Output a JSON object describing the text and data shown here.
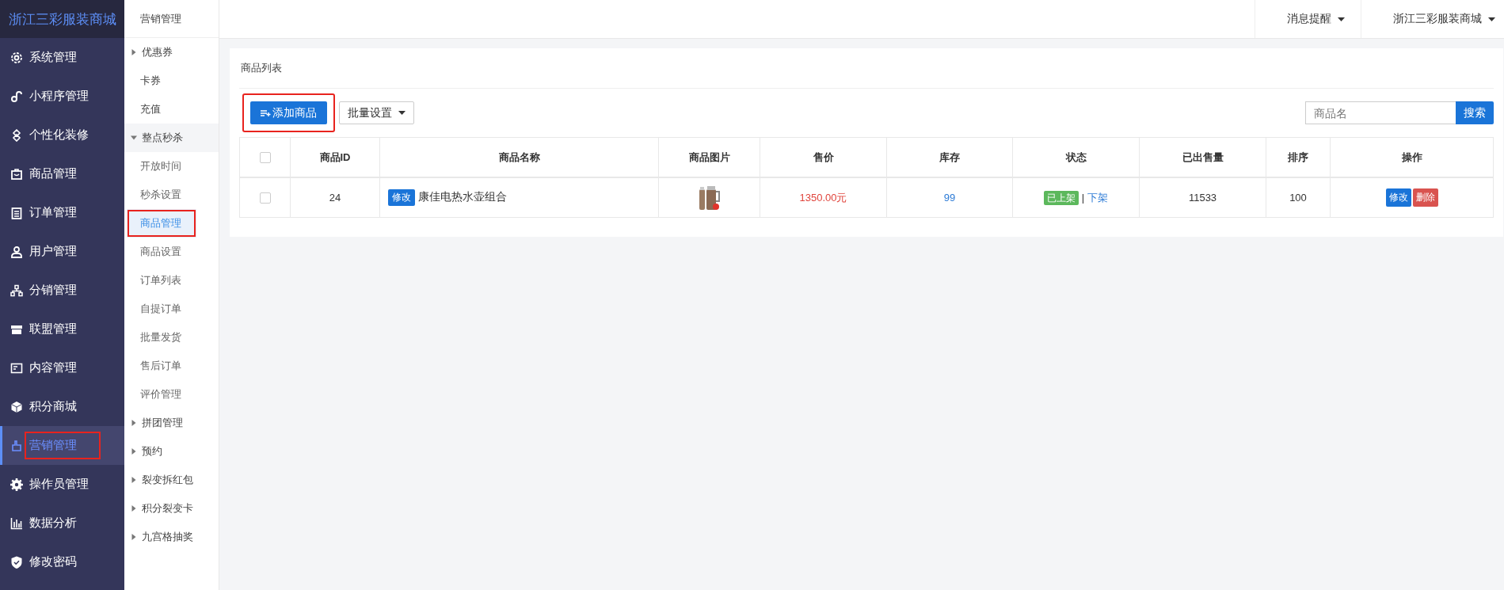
{
  "brand": "浙江三彩服装商城",
  "sidebar": {
    "items": [
      {
        "label": "系统管理",
        "selected": false,
        "annotated": false
      },
      {
        "label": "小程序管理",
        "selected": false,
        "annotated": false
      },
      {
        "label": "个性化装修",
        "selected": false,
        "annotated": false
      },
      {
        "label": "商品管理",
        "selected": false,
        "annotated": false
      },
      {
        "label": "订单管理",
        "selected": false,
        "annotated": false
      },
      {
        "label": "用户管理",
        "selected": false,
        "annotated": false
      },
      {
        "label": "分销管理",
        "selected": false,
        "annotated": false
      },
      {
        "label": "联盟管理",
        "selected": false,
        "annotated": false
      },
      {
        "label": "内容管理",
        "selected": false,
        "annotated": false
      },
      {
        "label": "积分商城",
        "selected": false,
        "annotated": false
      },
      {
        "label": "营销管理",
        "selected": true,
        "annotated": true
      },
      {
        "label": "操作员管理",
        "selected": false,
        "annotated": false
      },
      {
        "label": "数据分析",
        "selected": false,
        "annotated": false
      },
      {
        "label": "修改密码",
        "selected": false,
        "annotated": false
      }
    ]
  },
  "submenu": {
    "title": "营销管理",
    "items": [
      {
        "label": "优惠券",
        "kind": "group",
        "expanded": false
      },
      {
        "label": "卡券",
        "kind": "link",
        "selected": false,
        "annotated": false
      },
      {
        "label": "充值",
        "kind": "link",
        "selected": false,
        "annotated": false
      },
      {
        "label": "整点秒杀",
        "kind": "group",
        "expanded": true,
        "children": [
          {
            "label": "开放时间",
            "selected": false,
            "annotated": false
          },
          {
            "label": "秒杀设置",
            "selected": false,
            "annotated": false
          },
          {
            "label": "商品管理",
            "selected": true,
            "annotated": true
          },
          {
            "label": "商品设置",
            "selected": false,
            "annotated": false
          },
          {
            "label": "订单列表",
            "selected": false,
            "annotated": false
          },
          {
            "label": "自提订单",
            "selected": false,
            "annotated": false
          },
          {
            "label": "批量发货",
            "selected": false,
            "annotated": false
          },
          {
            "label": "售后订单",
            "selected": false,
            "annotated": false
          },
          {
            "label": "评价管理",
            "selected": false,
            "annotated": false
          }
        ]
      },
      {
        "label": "拼团管理",
        "kind": "group",
        "expanded": false
      },
      {
        "label": "预约",
        "kind": "group",
        "expanded": false
      },
      {
        "label": "裂变拆红包",
        "kind": "group",
        "expanded": false
      },
      {
        "label": "积分裂变卡",
        "kind": "group",
        "expanded": false
      },
      {
        "label": "九宫格抽奖",
        "kind": "group",
        "expanded": false
      }
    ]
  },
  "topbar": {
    "menus": [
      "消息提醒",
      "浙江三彩服装商城"
    ]
  },
  "panel": {
    "title": "商品列表",
    "add_button": {
      "label": "添加商品",
      "annotated": true
    },
    "batch_button": "批量设置",
    "search": {
      "placeholder": "商品名",
      "button": "搜索"
    },
    "table": {
      "header_checked": false,
      "columns": [
        "商品ID",
        "商品名称",
        "商品图片",
        "售价",
        "库存",
        "状态",
        "已出售量",
        "排序",
        "操作"
      ],
      "rows": [
        {
          "checked": false,
          "id": "24",
          "edit_tag": "修改",
          "name": "康佳电热水壶组合",
          "price": "1350.00元",
          "stock": "99",
          "status": "已上架",
          "status_separator": "|",
          "status_action": "下架",
          "sold": "11533",
          "sort": "100",
          "actions": [
            {
              "label": "修改",
              "kind": "primary"
            },
            {
              "label": "删除",
              "kind": "danger"
            }
          ]
        }
      ]
    }
  }
}
